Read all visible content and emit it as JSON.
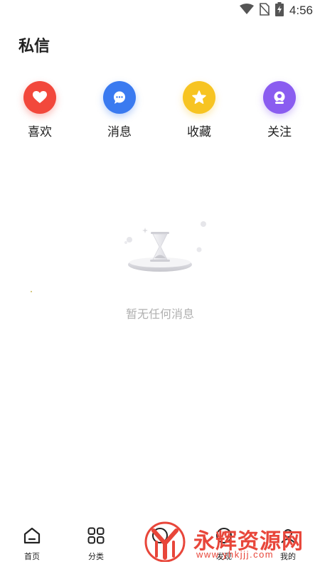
{
  "status_bar": {
    "time": "4:56",
    "icons": [
      "wifi-icon",
      "no-sim-icon",
      "battery-charging-icon"
    ]
  },
  "page": {
    "title": "私信"
  },
  "quick_actions": [
    {
      "label": "喜欢",
      "icon": "heart-icon",
      "color": "#f2483c"
    },
    {
      "label": "消息",
      "icon": "chat-bubble-icon",
      "color": "#3a7af0"
    },
    {
      "label": "收藏",
      "icon": "star-icon",
      "color": "#f7c422"
    },
    {
      "label": "关注",
      "icon": "user-badge-icon",
      "color": "#8a5cf0"
    }
  ],
  "empty_state": {
    "icon": "hourglass-icon",
    "text": "暂无任何消息"
  },
  "tab_bar": {
    "tabs": [
      {
        "label": "首页",
        "icon": "home-icon"
      },
      {
        "label": "分类",
        "icon": "grid-icon"
      },
      {
        "label": "",
        "icon": "center-icon"
      },
      {
        "label": "发现",
        "icon": "discover-icon"
      },
      {
        "label": "我的",
        "icon": "profile-icon"
      }
    ]
  },
  "watermark": {
    "text": "永辉资源网",
    "url": "www.yhkjjj.com",
    "color": "#e8463a"
  }
}
